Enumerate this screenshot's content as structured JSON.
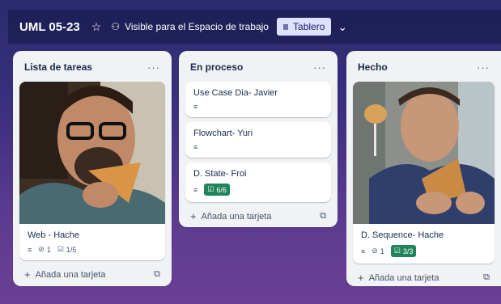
{
  "board": {
    "title": "UML 05-23",
    "visibility": "Visible para el Espacio de trabajo",
    "view": "Tablero",
    "star_icon": "star-icon",
    "visibility_icon": "people-icon",
    "view_icon": "board-icon",
    "chevron_icon": "chevron-down-icon"
  },
  "colors": {
    "board_bg_top": "#2a2c6e",
    "board_bg_bottom": "#6b3f93",
    "list_bg": "#f1f2f4",
    "check_done": "#1f845a"
  },
  "lists": [
    {
      "title": "Lista de tareas",
      "menu": "···",
      "add_label": "Añada una tarjeta",
      "cards": [
        {
          "title": "Web - Hache",
          "has_cover": true,
          "attachments": "1",
          "checklist": "1/5"
        }
      ]
    },
    {
      "title": "En proceso",
      "menu": "···",
      "add_label": "Añada una tarjeta",
      "cards": [
        {
          "title": "Use Case Dia- Javier"
        },
        {
          "title": "Flowchart- Yuri"
        },
        {
          "title": "D. State- Froi",
          "checklist": "6/6"
        }
      ]
    },
    {
      "title": "Hecho",
      "menu": "···",
      "add_label": "Añada una tarjeta",
      "cards": [
        {
          "title": "D. Sequence- Hache",
          "has_cover": true,
          "attachments": "1",
          "checklist": "3/3"
        }
      ]
    }
  ]
}
